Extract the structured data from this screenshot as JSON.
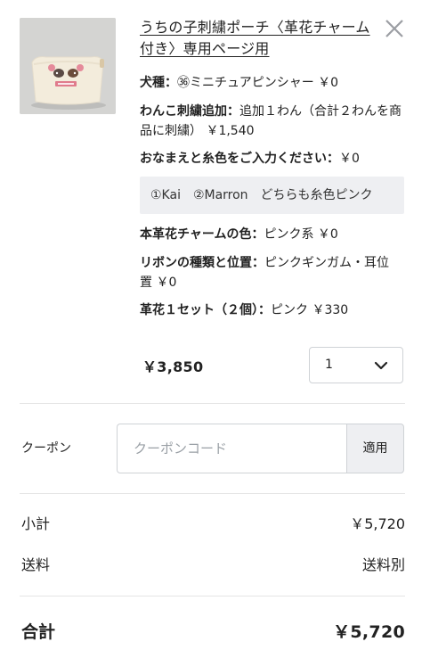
{
  "item": {
    "title": "うちの子刺繍ポーチ〈革花チャーム付き〉専用ページ用",
    "options": [
      {
        "label": "犬種：",
        "value": "㊱ミニチュアピンシャー ￥0"
      },
      {
        "label": "わんこ刺繍追加：",
        "value": "追加１わん（合計２わんを商品に刺繍） ￥1,540"
      },
      {
        "label": "おなまえと糸色をご入力ください：",
        "value": "￥0"
      },
      {
        "label": "本革花チャームの色：",
        "value": "ピンク系 ￥0"
      },
      {
        "label": "リボンの種類と位置：",
        "value": "ピンクギンガム・耳位置 ￥0"
      },
      {
        "label": "革花１セット（２個）：",
        "value": "ピンク ￥330"
      }
    ],
    "message": "①Kai　②Marron　どちらも糸色ピンク",
    "price": "￥3,850",
    "quantity": "1"
  },
  "coupon": {
    "label": "クーポン",
    "placeholder": "クーポンコード",
    "apply_label": "適用"
  },
  "summary": {
    "subtotal_label": "小計",
    "subtotal_value": "￥5,720",
    "shipping_label": "送料",
    "shipping_value": "送料別",
    "total_label": "合計",
    "total_value": "￥5,720"
  }
}
